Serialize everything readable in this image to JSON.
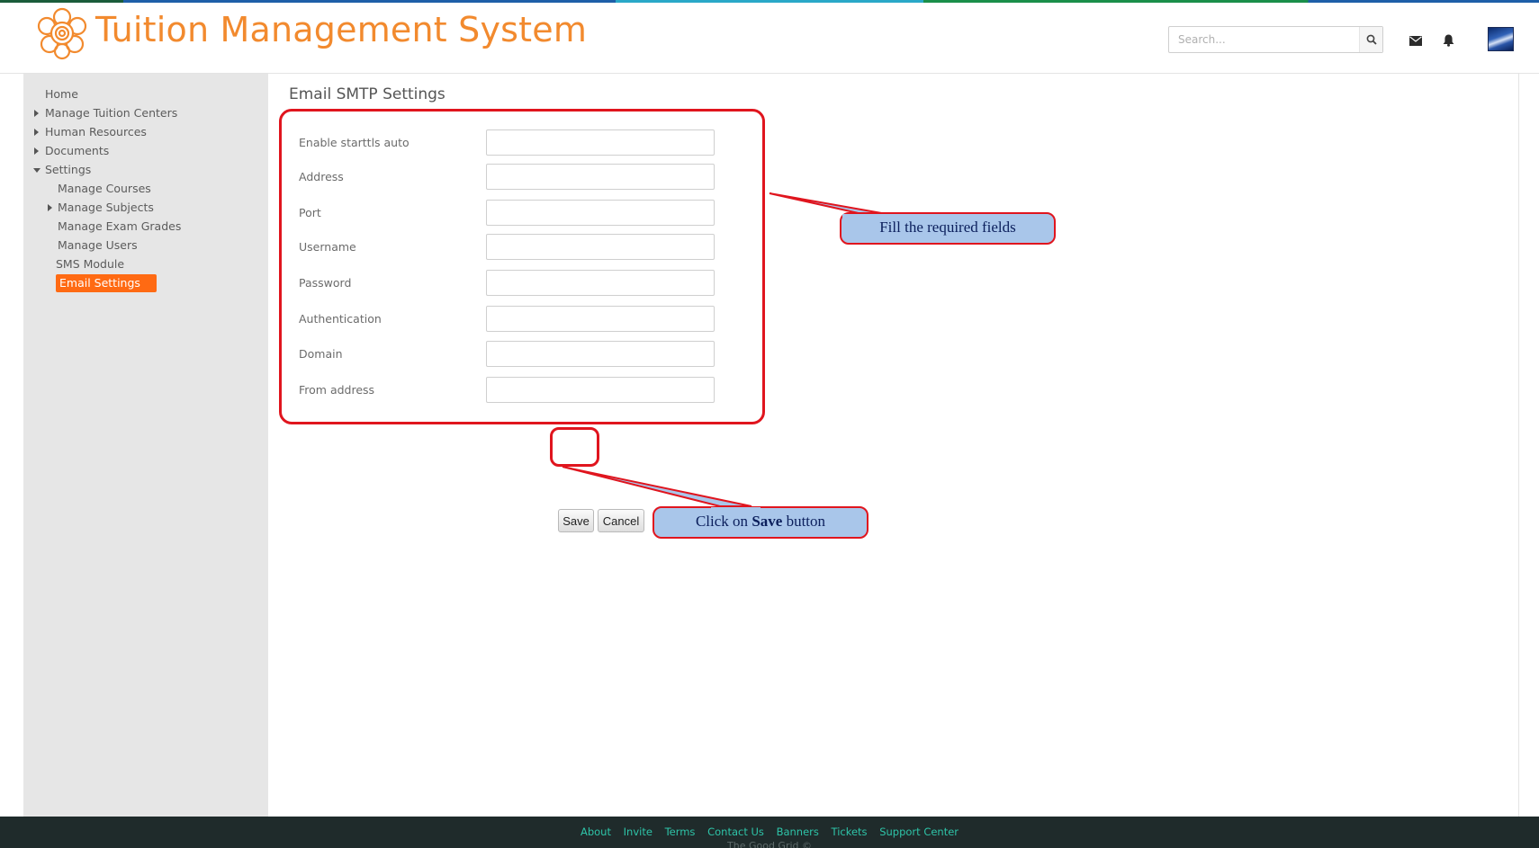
{
  "header": {
    "app_title": "Tuition Management System",
    "search_placeholder": "Search..."
  },
  "sidebar": {
    "items": [
      {
        "label": "Home",
        "level": 0,
        "arrow": "none"
      },
      {
        "label": "Manage Tuition Centers",
        "level": 0,
        "arrow": "right"
      },
      {
        "label": "Human Resources",
        "level": 0,
        "arrow": "right"
      },
      {
        "label": "Documents",
        "level": 0,
        "arrow": "right"
      },
      {
        "label": "Settings",
        "level": 0,
        "arrow": "down"
      },
      {
        "label": "Manage Courses",
        "level": 1,
        "arrow": "none"
      },
      {
        "label": "Manage Subjects",
        "level": 1,
        "arrow": "right"
      },
      {
        "label": "Manage Exam Grades",
        "level": 1,
        "arrow": "none"
      },
      {
        "label": "Manage Users",
        "level": 1,
        "arrow": "none"
      },
      {
        "label": "SMS Module",
        "level": 1,
        "arrow": "none"
      },
      {
        "label": "Email Settings",
        "level": 1,
        "arrow": "none",
        "active": true
      }
    ]
  },
  "main": {
    "page_title": "Email SMTP Settings",
    "fields": [
      {
        "label": "Enable starttls auto",
        "value": ""
      },
      {
        "label": "Address",
        "value": ""
      },
      {
        "label": "Port",
        "value": ""
      },
      {
        "label": "Username",
        "value": ""
      },
      {
        "label": "Password",
        "value": ""
      },
      {
        "label": "Authentication",
        "value": ""
      },
      {
        "label": "Domain",
        "value": ""
      },
      {
        "label": "From address",
        "value": ""
      }
    ],
    "save_label": "Save",
    "cancel_label": "Cancel"
  },
  "annotations": {
    "fill_fields": "Fill the required fields",
    "click_prefix": "Click on ",
    "click_bold": "Save",
    "click_suffix": " button"
  },
  "footer": {
    "links": [
      "About",
      "Invite",
      "Terms",
      "Contact Us",
      "Banners",
      "Tickets",
      "Support Center"
    ],
    "copyright": "The Good Grid ©"
  },
  "colors": {
    "brand_orange": "#f28a2e",
    "active_item": "#ff6a13",
    "highlight_red": "#e0151e",
    "callout_fill": "#a9c6ea",
    "footer_bg": "#1f2b2b",
    "footer_link": "#2ec4a8"
  },
  "icons": {
    "logo": "flower-logo-icon",
    "search": "search-icon",
    "mail": "envelope-icon",
    "notifications": "bell-icon"
  }
}
